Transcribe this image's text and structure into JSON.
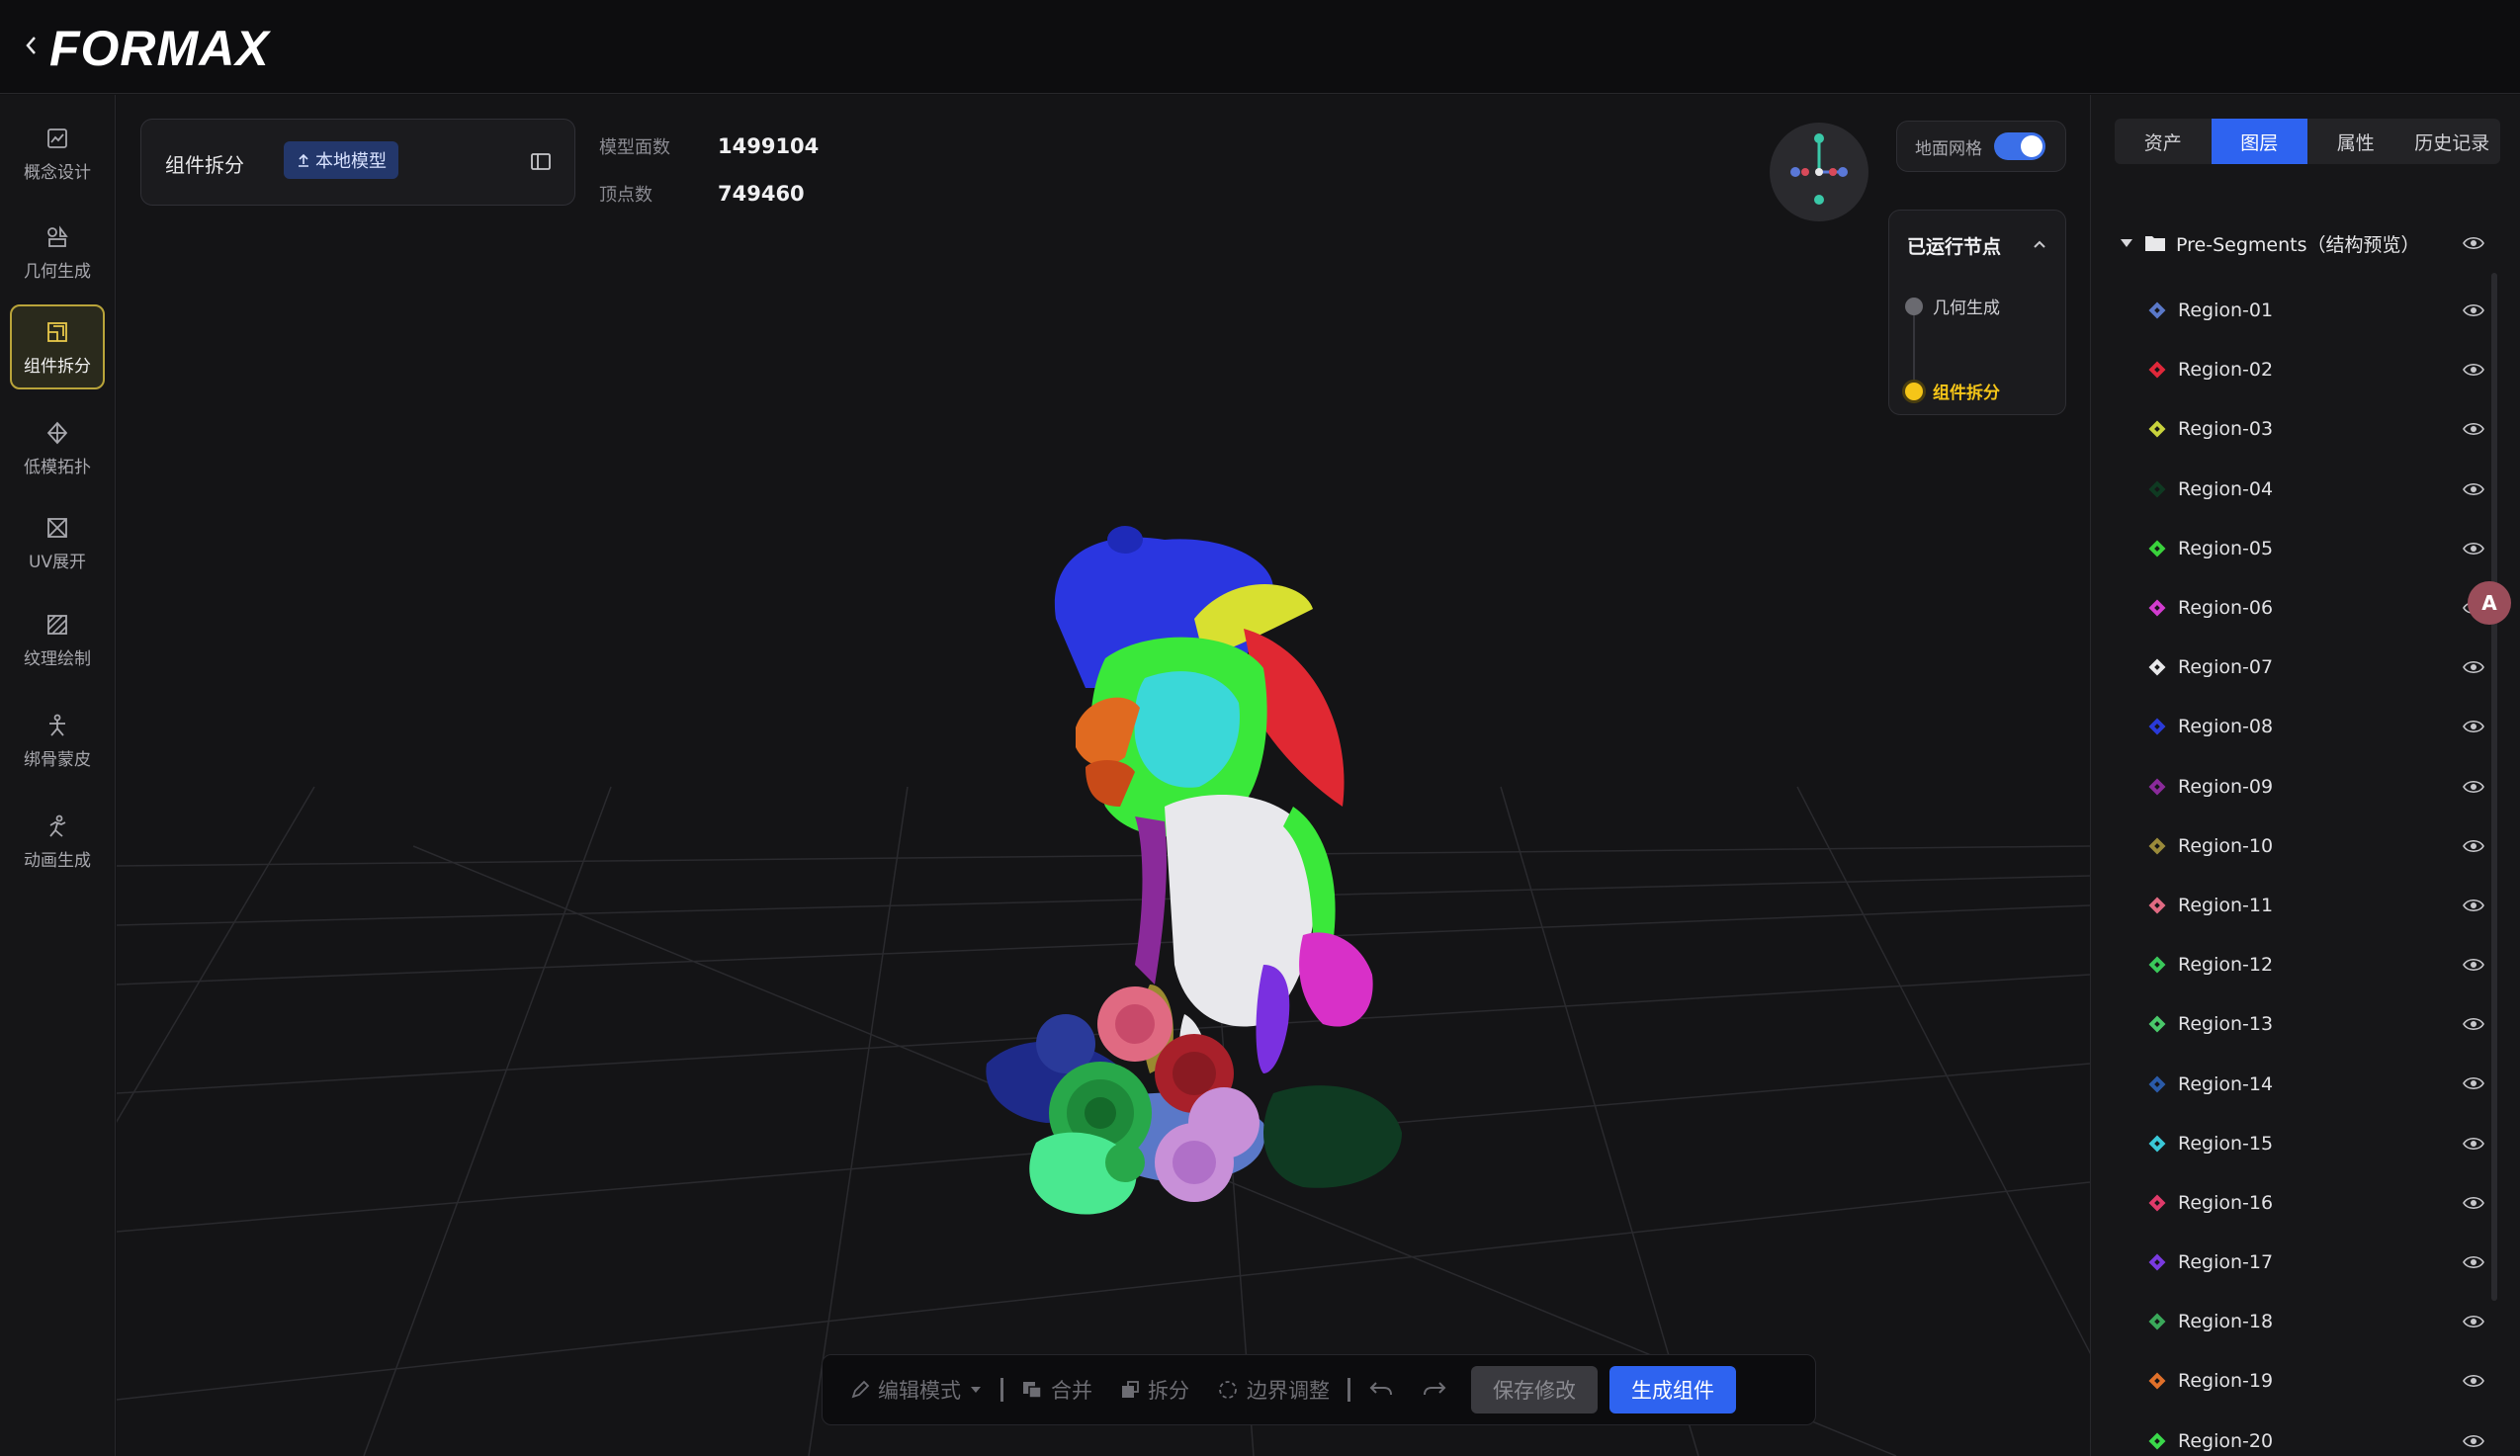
{
  "app": {
    "logo": "FORMAX"
  },
  "nav": {
    "items": [
      {
        "label": "概念设计",
        "icon": "concept-design-icon"
      },
      {
        "label": "几何生成",
        "icon": "geometry-icon"
      },
      {
        "label": "组件拆分",
        "icon": "component-split-icon",
        "active": true
      },
      {
        "label": "低模拓扑",
        "icon": "low-poly-icon"
      },
      {
        "label": "UV展开",
        "icon": "uv-unwrap-icon"
      },
      {
        "label": "纹理绘制",
        "icon": "texture-paint-icon"
      },
      {
        "label": "绑骨蒙皮",
        "icon": "rigging-icon"
      },
      {
        "label": "动画生成",
        "icon": "animation-icon"
      }
    ]
  },
  "segment_panel": {
    "title": "组件拆分",
    "local_model_button": "本地模型"
  },
  "stats": {
    "faces_label": "模型面数",
    "faces_value": "1499104",
    "vertices_label": "顶点数",
    "vertices_value": "749460"
  },
  "ground_grid": {
    "label": "地面网格",
    "enabled": true
  },
  "nodes": {
    "title": "已运行节点",
    "items": [
      {
        "label": "几何生成",
        "status_color": "#6a6a70",
        "text_color": "#d2d2d6"
      },
      {
        "label": "组件拆分",
        "status_color": "#f5c518",
        "text_color": "#f5c518"
      }
    ]
  },
  "toolbar": {
    "edit_mode": "编辑模式",
    "merge": "合并",
    "split": "拆分",
    "boundary": "边界调整",
    "save": "保存修改",
    "generate": "生成组件"
  },
  "right_panel": {
    "tabs": [
      {
        "label": "资产",
        "active": false
      },
      {
        "label": "图层",
        "active": true
      },
      {
        "label": "属性",
        "active": false
      },
      {
        "label": "历史记录",
        "active": false
      }
    ],
    "tree_root": "Pre-Segments（结构预览）",
    "regions": [
      {
        "name": "Region-01",
        "color": "#5a78c8"
      },
      {
        "name": "Region-02",
        "color": "#e0283a"
      },
      {
        "name": "Region-03",
        "color": "#c8d23c"
      },
      {
        "name": "Region-04",
        "color": "#0f3a22"
      },
      {
        "name": "Region-05",
        "color": "#3ad23c"
      },
      {
        "name": "Region-06",
        "color": "#d23ccf"
      },
      {
        "name": "Region-07",
        "color": "#e8e8ea"
      },
      {
        "name": "Region-08",
        "color": "#2a3ad8"
      },
      {
        "name": "Region-09",
        "color": "#8a2a9a"
      },
      {
        "name": "Region-10",
        "color": "#9a8a3a"
      },
      {
        "name": "Region-11",
        "color": "#e06a82"
      },
      {
        "name": "Region-12",
        "color": "#3ac85a"
      },
      {
        "name": "Region-13",
        "color": "#4ac86a"
      },
      {
        "name": "Region-14",
        "color": "#2a5aa8"
      },
      {
        "name": "Region-15",
        "color": "#3ac8d8"
      },
      {
        "name": "Region-16",
        "color": "#e03a6a"
      },
      {
        "name": "Region-17",
        "color": "#7a3ae0"
      },
      {
        "name": "Region-18",
        "color": "#3aa85a"
      },
      {
        "name": "Region-19",
        "color": "#e0702a"
      },
      {
        "name": "Region-20",
        "color": "#3ad84a"
      }
    ]
  },
  "float_button": {
    "label": "A"
  }
}
